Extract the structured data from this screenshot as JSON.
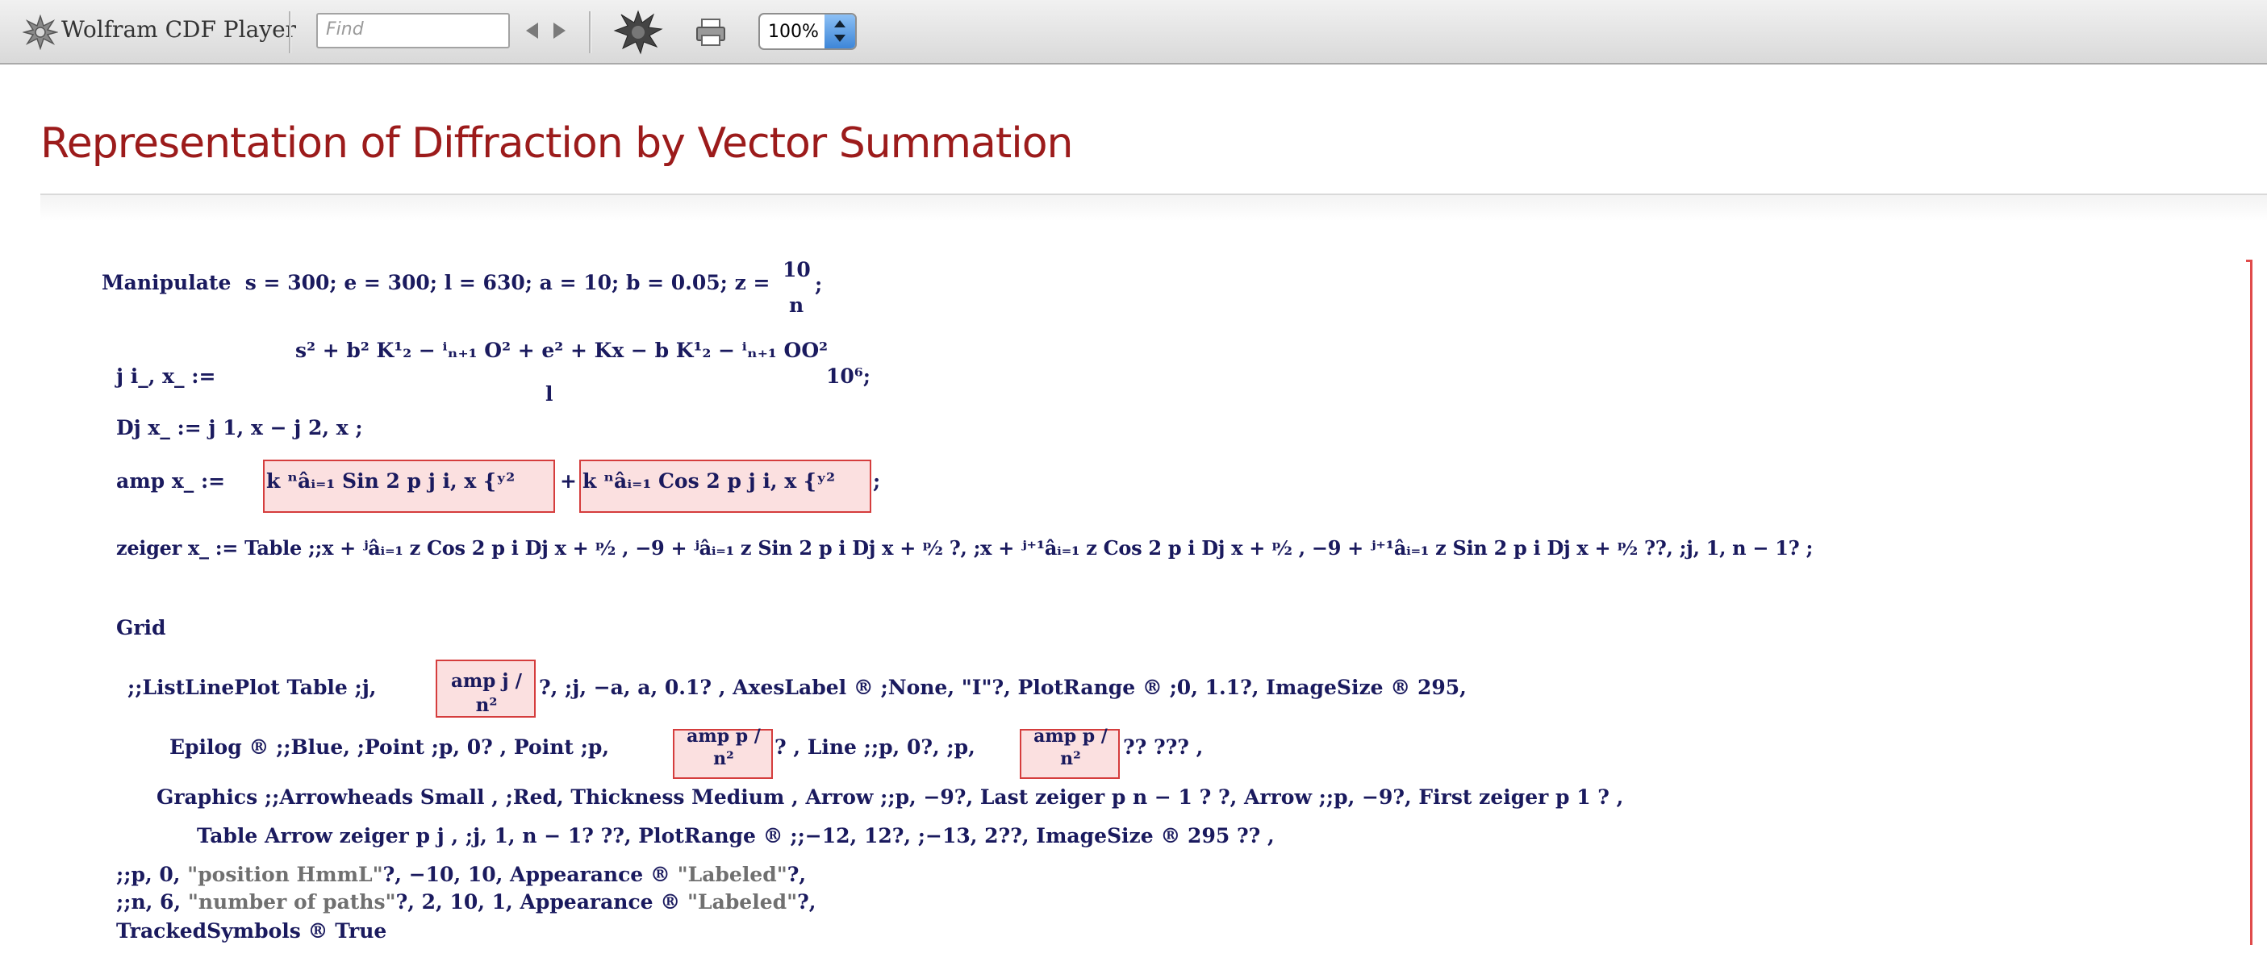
{
  "toolbar": {
    "app_title": "Wolfram CDF Player",
    "find_placeholder": "Find",
    "zoom_value": "100%",
    "icons": [
      "wolfram-spikey-icon",
      "prev-icon",
      "next-icon",
      "spikey-evaluate-icon",
      "print-icon",
      "stepper-icon"
    ]
  },
  "document": {
    "title": "Representation of Diffraction by Vector Summation",
    "code": {
      "l1_kw": "Manipulate",
      "l1_body": "s = 300; e = 300; l = 630; a = 10; b = 0.05; z =",
      "l1_num": "10",
      "l1_den": "n",
      "l1_end": ";",
      "l2_a": "j   i_, x_     :=",
      "l2_b": "s² + b² K¹₂ − ⁱₙ₊₁ O² +   e² + Kx − b K¹₂ − ⁱₙ₊₁ OO²",
      "l2_c": "l",
      "l2_d": "10⁶;",
      "l3": "Dj   x_     := j   1, x   − j   2, x   ;",
      "l4_a": "amp   x_     :=",
      "l4_b": "k ⁿâᵢ₌₁ Sin   2 p j   i, x      {ʸ²",
      "l4_plus": "+",
      "l4_c": "k ⁿâᵢ₌₁ Cos   2 p j   i, x      {ʸ²",
      "l4_end": ";",
      "l5": "zeiger   x_     := Table   ;;x + ʲâᵢ₌₁ z Cos   2 p i Dj   x   + ᵖ⁄₂  , −9 + ʲâᵢ₌₁ z Sin   2 p i Dj   x   + ᵖ⁄₂  ?, ;x + ʲ⁺¹âᵢ₌₁ z Cos   2 p i Dj   x   + ᵖ⁄₂  , −9 + ʲ⁺¹âᵢ₌₁ z Sin   2 p i Dj   x   + ᵖ⁄₂  ??, ;j, 1, n − 1?   ;",
      "l6": "Grid",
      "l7_a": ";;ListLinePlot   Table   ;j,",
      "l7_box": "amp   j / n²",
      "l7_b": "?, ;j, −a, a, 0.1?   , AxesLabel ® ;None, \"I\"?, PlotRange ® ;0, 1.1?, ImageSize ® 295,",
      "l8_a": "Epilog ® ;;Blue, ;Point   ;p, 0?   , Point   ;p,",
      "l8_box1": "amp   p / n²",
      "l8_b": "?   , Line   ;;p, 0?, ;p,",
      "l8_box2": "amp   p / n²",
      "l8_c": "??   ???   ,",
      "l9": "Graphics   ;;Arrowheads   Small   , ;Red, Thickness   Medium   , Arrow   ;;p, −9?, Last   zeiger   p     n − 1     ?  ?, Arrow   ;;p, −9?, First   zeiger   p     1     ?   ,",
      "l10": "Table   Arrow   zeiger   p     j     , ;j, 1, n − 1?   ??, PlotRange ® ;;−12, 12?, ;−13, 2??, ImageSize ® 295   ??   ,",
      "l11_a": ";;p, 0,",
      "l11_str": "\"position HmmL\"",
      "l11_b": "?, −10, 10, Appearance ®",
      "l11_str2": "\"Labeled\"",
      "l11_end": "?,",
      "l12_a": ";;n, 6,",
      "l12_str": "\"number of paths\"",
      "l12_b": "?, 2, 10, 1, Appearance ®",
      "l12_str2": "\"Labeled\"",
      "l12_end": "?,",
      "l13": "TrackedSymbols ® True"
    }
  },
  "colors": {
    "title": "#9c1b1b",
    "code": "#1a1a5e",
    "variable": "#3f7a3f",
    "string": "#707070",
    "error_box": "#d53d3d",
    "bracket": "#e04b4b"
  }
}
